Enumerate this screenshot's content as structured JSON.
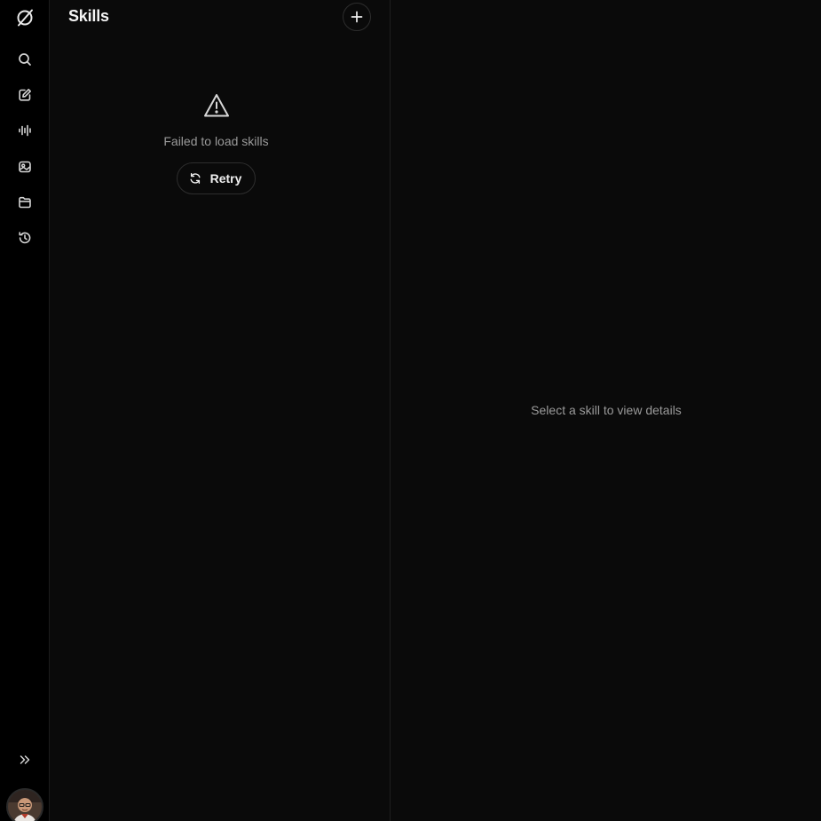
{
  "rail": {
    "items": [
      {
        "name": "logo-icon",
        "icon": "slashed-circle"
      },
      {
        "name": "search-icon",
        "icon": "search"
      },
      {
        "name": "new-chat-icon",
        "icon": "pencil-square"
      },
      {
        "name": "voice-icon",
        "icon": "waveform"
      },
      {
        "name": "media-icon",
        "icon": "photo-box"
      },
      {
        "name": "folder-icon",
        "icon": "folder"
      },
      {
        "name": "history-icon",
        "icon": "clock-rewind"
      }
    ],
    "expand_icon": "double-chevron-right",
    "avatar_alt": "User avatar"
  },
  "skills": {
    "title": "Skills",
    "add_icon": "plus",
    "error_message": "Failed to load skills",
    "retry_label": "Retry"
  },
  "detail": {
    "empty_message": "Select a skill to view details"
  },
  "colors": {
    "background": "#0a0a0a",
    "rail_background": "#000000",
    "muted_text": "#9a9a9a",
    "border": "#2e2e2e"
  }
}
